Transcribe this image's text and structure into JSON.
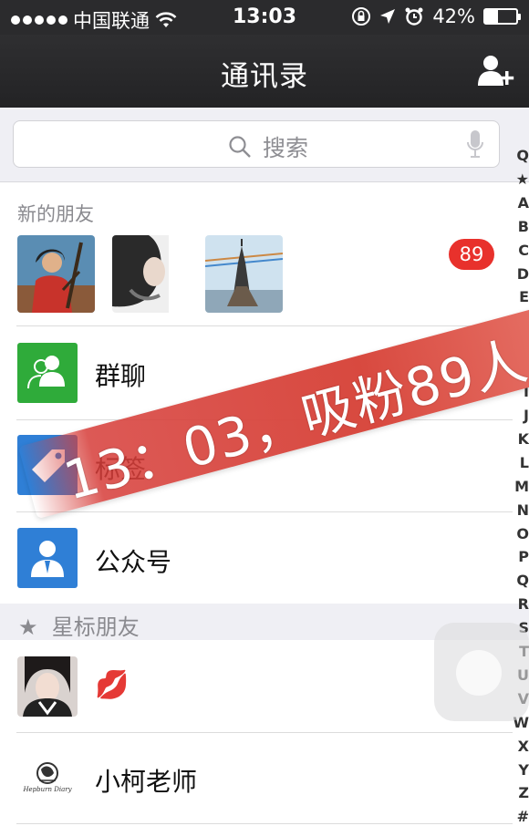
{
  "status_bar": {
    "carrier": "中国联通",
    "time": "13:03",
    "battery": "42%",
    "battery_level": 0.42
  },
  "nav": {
    "title": "通讯录",
    "add_icon": "add-friend-icon"
  },
  "search": {
    "placeholder": "搜索",
    "mic_icon": "microphone-icon"
  },
  "new_friends": {
    "label": "新的朋友",
    "badge": "89"
  },
  "menu": [
    {
      "label": "群聊",
      "icon": "group-chat-icon",
      "color": "#2fab3a"
    },
    {
      "label": "标签",
      "icon": "tag-icon",
      "color": "#2f7fd6"
    },
    {
      "label": "公众号",
      "icon": "official-account-icon",
      "color": "#2f7fd6"
    }
  ],
  "starred": {
    "label": "星标朋友",
    "contacts": [
      {
        "name": "💋"
      },
      {
        "name": "小柯老师",
        "avatar_text": "Hepburn Diary"
      }
    ]
  },
  "index_letters": [
    "Q",
    "★",
    "A",
    "B",
    "C",
    "D",
    "E",
    "F",
    "G",
    "H",
    "I",
    "J",
    "K",
    "L",
    "M",
    "N",
    "O",
    "P",
    "Q",
    "R",
    "S",
    "T",
    "U",
    "V",
    "W",
    "X",
    "Y",
    "Z",
    "#"
  ],
  "banner": {
    "text": "13：03，吸粉89人"
  }
}
